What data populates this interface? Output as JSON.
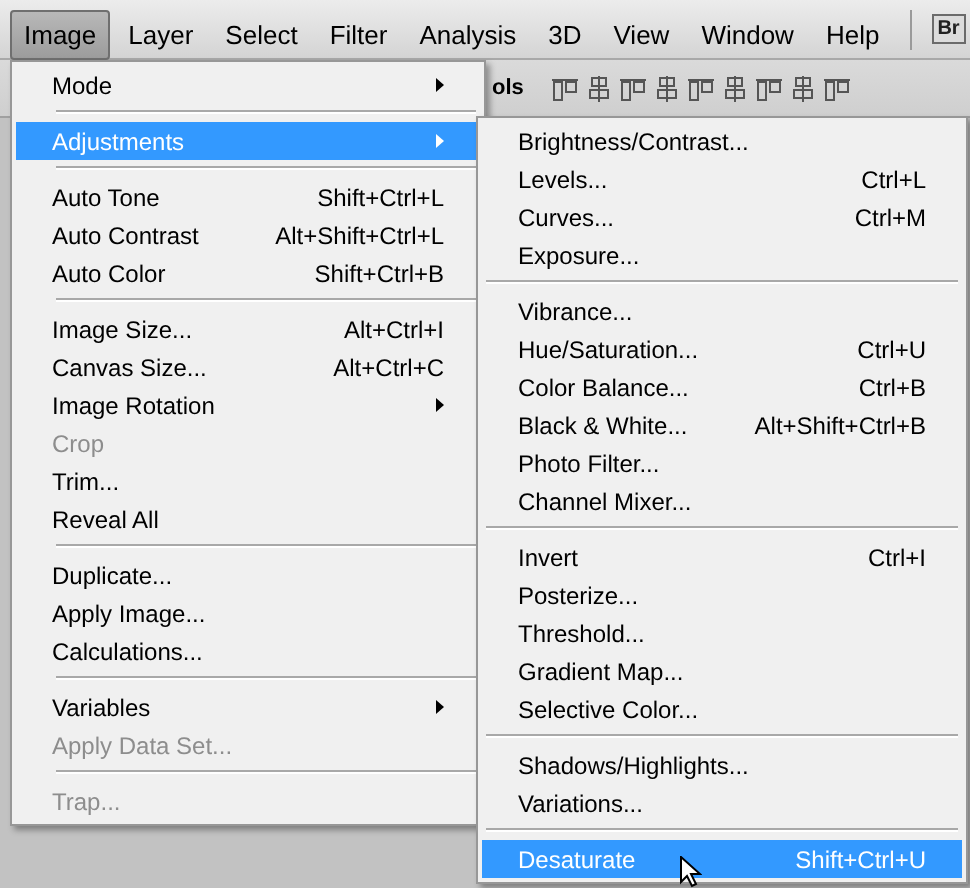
{
  "menubar": [
    {
      "label": "Image",
      "selected": true
    },
    {
      "label": "Layer",
      "selected": false
    },
    {
      "label": "Select",
      "selected": false
    },
    {
      "label": "Filter",
      "selected": false
    },
    {
      "label": "Analysis",
      "selected": false
    },
    {
      "label": "3D",
      "selected": false
    },
    {
      "label": "View",
      "selected": false
    },
    {
      "label": "Window",
      "selected": false
    },
    {
      "label": "Help",
      "selected": false
    }
  ],
  "bridge_button": "Br",
  "options_bar": {
    "label": "ols"
  },
  "image_menu": [
    {
      "kind": "item",
      "label": "Mode",
      "submenu": true,
      "selected": false,
      "disabled": false
    },
    {
      "kind": "separator"
    },
    {
      "kind": "item",
      "label": "Adjustments",
      "submenu": true,
      "selected": true,
      "disabled": false
    },
    {
      "kind": "separator"
    },
    {
      "kind": "item",
      "label": "Auto Tone",
      "shortcut": "Shift+Ctrl+L",
      "selected": false,
      "disabled": false
    },
    {
      "kind": "item",
      "label": "Auto Contrast",
      "shortcut": "Alt+Shift+Ctrl+L",
      "selected": false,
      "disabled": false
    },
    {
      "kind": "item",
      "label": "Auto Color",
      "shortcut": "Shift+Ctrl+B",
      "selected": false,
      "disabled": false
    },
    {
      "kind": "separator"
    },
    {
      "kind": "item",
      "label": "Image Size...",
      "shortcut": "Alt+Ctrl+I",
      "selected": false,
      "disabled": false
    },
    {
      "kind": "item",
      "label": "Canvas Size...",
      "shortcut": "Alt+Ctrl+C",
      "selected": false,
      "disabled": false
    },
    {
      "kind": "item",
      "label": "Image Rotation",
      "submenu": true,
      "selected": false,
      "disabled": false
    },
    {
      "kind": "item",
      "label": "Crop",
      "selected": false,
      "disabled": true
    },
    {
      "kind": "item",
      "label": "Trim...",
      "selected": false,
      "disabled": false
    },
    {
      "kind": "item",
      "label": "Reveal All",
      "selected": false,
      "disabled": false
    },
    {
      "kind": "separator"
    },
    {
      "kind": "item",
      "label": "Duplicate...",
      "selected": false,
      "disabled": false
    },
    {
      "kind": "item",
      "label": "Apply Image...",
      "selected": false,
      "disabled": false
    },
    {
      "kind": "item",
      "label": "Calculations...",
      "selected": false,
      "disabled": false
    },
    {
      "kind": "separator"
    },
    {
      "kind": "item",
      "label": "Variables",
      "submenu": true,
      "selected": false,
      "disabled": false
    },
    {
      "kind": "item",
      "label": "Apply Data Set...",
      "selected": false,
      "disabled": true
    },
    {
      "kind": "separator"
    },
    {
      "kind": "item",
      "label": "Trap...",
      "selected": false,
      "disabled": true
    }
  ],
  "adjustments_menu": [
    {
      "kind": "item",
      "label": "Brightness/Contrast...",
      "selected": false
    },
    {
      "kind": "item",
      "label": "Levels...",
      "shortcut": "Ctrl+L",
      "selected": false
    },
    {
      "kind": "item",
      "label": "Curves...",
      "shortcut": "Ctrl+M",
      "selected": false
    },
    {
      "kind": "item",
      "label": "Exposure...",
      "selected": false
    },
    {
      "kind": "separator"
    },
    {
      "kind": "item",
      "label": "Vibrance...",
      "selected": false
    },
    {
      "kind": "item",
      "label": "Hue/Saturation...",
      "shortcut": "Ctrl+U",
      "selected": false
    },
    {
      "kind": "item",
      "label": "Color Balance...",
      "shortcut": "Ctrl+B",
      "selected": false
    },
    {
      "kind": "item",
      "label": "Black & White...",
      "shortcut": "Alt+Shift+Ctrl+B",
      "selected": false
    },
    {
      "kind": "item",
      "label": "Photo Filter...",
      "selected": false
    },
    {
      "kind": "item",
      "label": "Channel Mixer...",
      "selected": false
    },
    {
      "kind": "separator"
    },
    {
      "kind": "item",
      "label": "Invert",
      "shortcut": "Ctrl+I",
      "selected": false
    },
    {
      "kind": "item",
      "label": "Posterize...",
      "selected": false
    },
    {
      "kind": "item",
      "label": "Threshold...",
      "selected": false
    },
    {
      "kind": "item",
      "label": "Gradient Map...",
      "selected": false
    },
    {
      "kind": "item",
      "label": "Selective Color...",
      "selected": false
    },
    {
      "kind": "separator"
    },
    {
      "kind": "item",
      "label": "Shadows/Highlights...",
      "selected": false
    },
    {
      "kind": "item",
      "label": "Variations...",
      "selected": false
    },
    {
      "kind": "separator"
    },
    {
      "kind": "item",
      "label": "Desaturate",
      "shortcut": "Shift+Ctrl+U",
      "selected": true
    }
  ]
}
